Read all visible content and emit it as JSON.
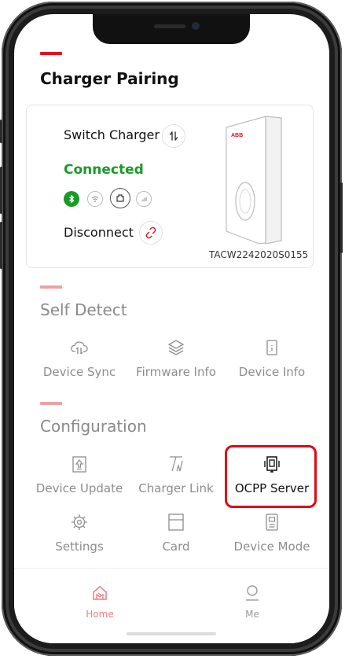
{
  "header": {
    "title": "Charger Pairing"
  },
  "charger": {
    "switch_label": "Switch Charger",
    "status": "Connected",
    "disconnect_label": "Disconnect",
    "serial": "TACW2242020S0155",
    "brand_mark": "ABB"
  },
  "self_detect": {
    "title": "Self Detect",
    "items": [
      {
        "label": "Device Sync",
        "icon": "cloud-sync-icon"
      },
      {
        "label": "Firmware Info",
        "icon": "layers-icon"
      },
      {
        "label": "Device Info",
        "icon": "device-info-icon"
      }
    ]
  },
  "configuration": {
    "title": "Configuration",
    "items": [
      {
        "label": "Device Update",
        "icon": "update-icon"
      },
      {
        "label": "Charger Link",
        "icon": "charger-link-icon"
      },
      {
        "label": "OCPP Server",
        "icon": "server-icon"
      },
      {
        "label": "Settings",
        "icon": "gear-icon"
      },
      {
        "label": "Card",
        "icon": "card-icon"
      },
      {
        "label": "Device Mode",
        "icon": "device-mode-icon"
      }
    ]
  },
  "tabbar": {
    "items": [
      {
        "label": "Home",
        "icon": "home-icon",
        "active": true
      },
      {
        "label": "Me",
        "icon": "person-icon",
        "active": false
      }
    ]
  },
  "colors": {
    "accent": "#e4111b",
    "connected": "#1a9a28",
    "highlight": "#e30613",
    "muted_text": "#8d8d8d"
  }
}
